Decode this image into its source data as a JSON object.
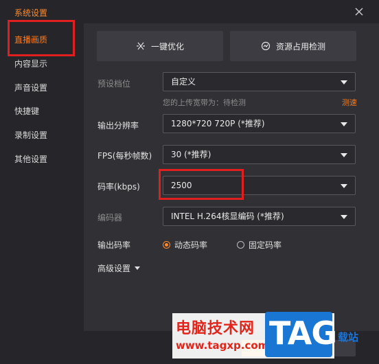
{
  "window": {
    "title": "系统设置",
    "close_icon": "close-icon"
  },
  "sidebar": {
    "items": [
      {
        "label": "直播画质",
        "active": true
      },
      {
        "label": "内容显示"
      },
      {
        "label": "声音设置"
      },
      {
        "label": "快捷键"
      },
      {
        "label": "录制设置"
      },
      {
        "label": "其他设置"
      }
    ]
  },
  "toolbar": {
    "optimize_label": "一键优化",
    "optimize_icon": "wand-icon",
    "resource_label": "资源占用检测",
    "resource_icon": "gauge-icon"
  },
  "form": {
    "preset": {
      "label": "预设档位",
      "value": "自定义"
    },
    "bandwidth_hint": "您的上传宽带为：待检测",
    "speed_test_label": "测速",
    "resolution": {
      "label": "输出分辨率",
      "value": "1280*720 720P (*推荐)"
    },
    "fps": {
      "label": "FPS(每秒帧数)",
      "value": "30 (*推荐)"
    },
    "bitrate": {
      "label": "码率(kbps)",
      "value": "2500"
    },
    "encoder": {
      "label": "编码器",
      "value": "INTEL H.264核显编码 (*推荐)"
    },
    "rate_mode": {
      "label": "输出码率",
      "options": [
        {
          "label": "动态码率",
          "checked": true
        },
        {
          "label": "固定码率",
          "checked": false
        }
      ]
    },
    "advanced_label": "高级设置"
  },
  "watermark": {
    "title": "电脑技术网",
    "url": "www.tagxp.com",
    "logo": "TAG",
    "side_text": "载站"
  },
  "colors": {
    "accent": "#ff7a1a",
    "highlight_box": "#e11f1f",
    "watermark_red": "#e1251b",
    "watermark_blue": "#1976d2"
  }
}
